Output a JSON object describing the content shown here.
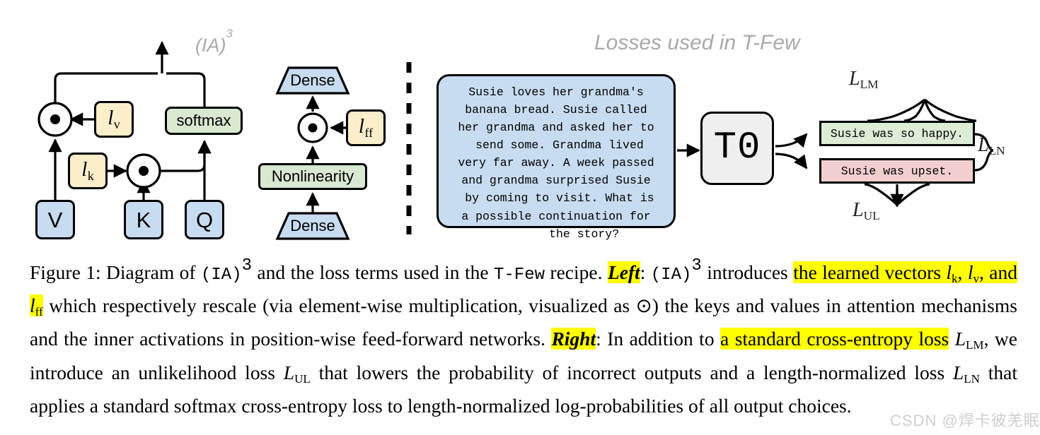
{
  "figure": {
    "left_panel": {
      "title": "(IA)",
      "title_sup": "3",
      "nodes": {
        "v": "V",
        "k": "K",
        "q": "Q",
        "l_v": "l",
        "l_v_sub": "v",
        "l_k": "l",
        "l_k_sub": "k",
        "softmax": "softmax",
        "dense_top": "Dense",
        "dense_bottom": "Dense",
        "nonlinearity": "Nonlinearity",
        "l_ff": "l",
        "l_ff_sub": "ff"
      }
    },
    "right_panel": {
      "title": "Losses used in T-Few",
      "prompt": "Susie loves her grandma's\nbanana bread. Susie called\nher grandma and asked her to\n send some. Grandma lived\nvery far away. A week passed\nand grandma surprised Susie\n by coming to visit. What is\na possible continuation for\n        the story?",
      "model": "T0",
      "answer_positive": "Susie was so happy.",
      "answer_negative": "Susie was upset.",
      "losses": {
        "lm": "L",
        "lm_sub": "LM",
        "ul": "L",
        "ul_sub": "UL",
        "ln": "L",
        "ln_sub": "LN"
      }
    },
    "colors": {
      "blue_box": "#c7dcf0",
      "yellow_box": "#fbeecb",
      "green_box": "#d8e8d1",
      "grey_box": "#efefef",
      "answer_positive_bg": "#dcecd5",
      "answer_negative_bg": "#f2cfcf",
      "title_grey": "#a9a9a9",
      "highlight": "#ffff00"
    }
  },
  "caption": {
    "s1": "Figure 1: Diagram of ",
    "s2_mono": "(IA)",
    "s2_sup": "3",
    "s3": " and the loss terms used in the ",
    "s4_mono": "T-Few",
    "s5": " recipe. ",
    "s6_left": "Left",
    "s7": ": ",
    "s8_mono": "(IA)",
    "s8_sup": "3",
    "s9": " introduces ",
    "s10_hl_a": "the learned vectors ",
    "s11_lk": "l",
    "s11_lk_sub": "k",
    "s12": ", ",
    "s13_lv": "l",
    "s13_lv_sub": "v",
    "s14": ", and ",
    "s15_lff": "l",
    "s15_lff_sub": "ff",
    "s16": " which respectively rescale (via element-wise multiplication, visualized as ",
    "s17_odot": "⊙",
    "s18": ") the keys and values in attention mechanisms and the inner activations in position-wise feed-forward networks. ",
    "s19_right": "Right",
    "s20": ": In addition to ",
    "s21_hl": "a standard cross-entropy loss",
    "s22": " ",
    "s23_llm": "L",
    "s23_llm_sub": "LM",
    "s24": ", we introduce an unlikelihood loss ",
    "s25_lul": "L",
    "s25_lul_sub": "UL",
    "s26": " that lowers the probability of incorrect outputs and a length-normalized loss ",
    "s27_lln": "L",
    "s27_lln_sub": "LN",
    "s28": " that applies a standard ",
    "s29_mono": "softmax",
    "s30": " cross-entropy loss to length-normalized log-probabilities of all output choices."
  },
  "watermark": {
    "text": "CSDN @焊卡彼羌眠"
  }
}
